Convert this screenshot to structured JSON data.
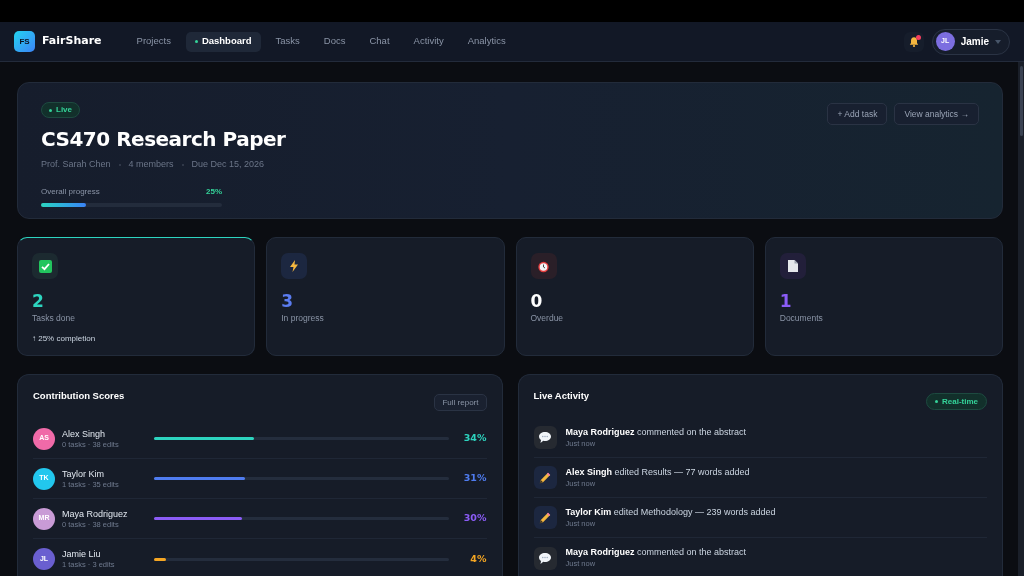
{
  "brand": {
    "logo": "FS",
    "name": "FairShare"
  },
  "nav": [
    {
      "label": "Projects",
      "selected": false
    },
    {
      "label": "Dashboard",
      "selected": true
    },
    {
      "label": "Tasks",
      "selected": false
    },
    {
      "label": "Docs",
      "selected": false
    },
    {
      "label": "Chat",
      "selected": false
    },
    {
      "label": "Activity",
      "selected": false
    },
    {
      "label": "Analytics",
      "selected": false
    }
  ],
  "notifications": {
    "unread": true
  },
  "user": {
    "initials": "JL",
    "name": "Jamie"
  },
  "project": {
    "badge": "Live",
    "title": "CS470 Research Paper",
    "meta": [
      "Prof. Sarah Chen",
      "4 members",
      "Due Dec 15, 2026"
    ],
    "progress_label": "Overall progress",
    "progress_reading": "25%",
    "level": 0.25,
    "actions": [
      "+ Add task",
      "View analytics →"
    ]
  },
  "stats": [
    {
      "kind": "done",
      "value": "2",
      "label": "Tasks done",
      "note": "↑ 25% completion",
      "highlighted": true
    },
    {
      "kind": "progress",
      "value": "3",
      "label": "In progress",
      "highlighted": false
    },
    {
      "kind": "overdue",
      "value": "0",
      "label": "Overdue",
      "highlighted": false
    },
    {
      "kind": "documents",
      "value": "1",
      "label": "Documents",
      "highlighted": false
    }
  ],
  "contributions": {
    "title": "Contribution Scores",
    "action": "Full report",
    "members": [
      {
        "avatar": {
          "initials": "AS",
          "color": "#f06aa8"
        },
        "name": "Alex Singh",
        "detail": "0 tasks · 38 edits",
        "level": 0.34,
        "reading": "34%",
        "color": "#2dd4bf"
      },
      {
        "avatar": {
          "initials": "TK",
          "color": "#22c7ee"
        },
        "name": "Taylor Kim",
        "detail": "1 tasks · 35 edits",
        "level": 0.31,
        "reading": "31%",
        "color": "#4f7cf0"
      },
      {
        "avatar": {
          "initials": "MR",
          "color": "#c99bd6"
        },
        "name": "Maya Rodriguez",
        "detail": "0 tasks · 38 edits",
        "level": 0.3,
        "reading": "30%",
        "color": "#8b5cf6"
      },
      {
        "avatar": {
          "initials": "JL",
          "color": "#6a5fd0"
        },
        "name": "Jamie Liu",
        "detail": "1 tasks · 3 edits",
        "level": 0.04,
        "reading": "4%",
        "color": "#f5a623"
      }
    ]
  },
  "activity": {
    "title": "Live Activity",
    "badge": "Real-time",
    "items": [
      {
        "kind": "comment",
        "text": "**Maya Rodriguez** commented on the abstract",
        "time": "Just now"
      },
      {
        "kind": "edit",
        "text": "**Alex Singh** edited Results — 77 words added",
        "time": "Just now"
      },
      {
        "kind": "edit",
        "text": "**Taylor Kim** edited Methodology — 239 words added",
        "time": "Just now"
      },
      {
        "kind": "comment",
        "text": "**Maya Rodriguez** commented on the abstract",
        "time": "Just now"
      }
    ]
  }
}
